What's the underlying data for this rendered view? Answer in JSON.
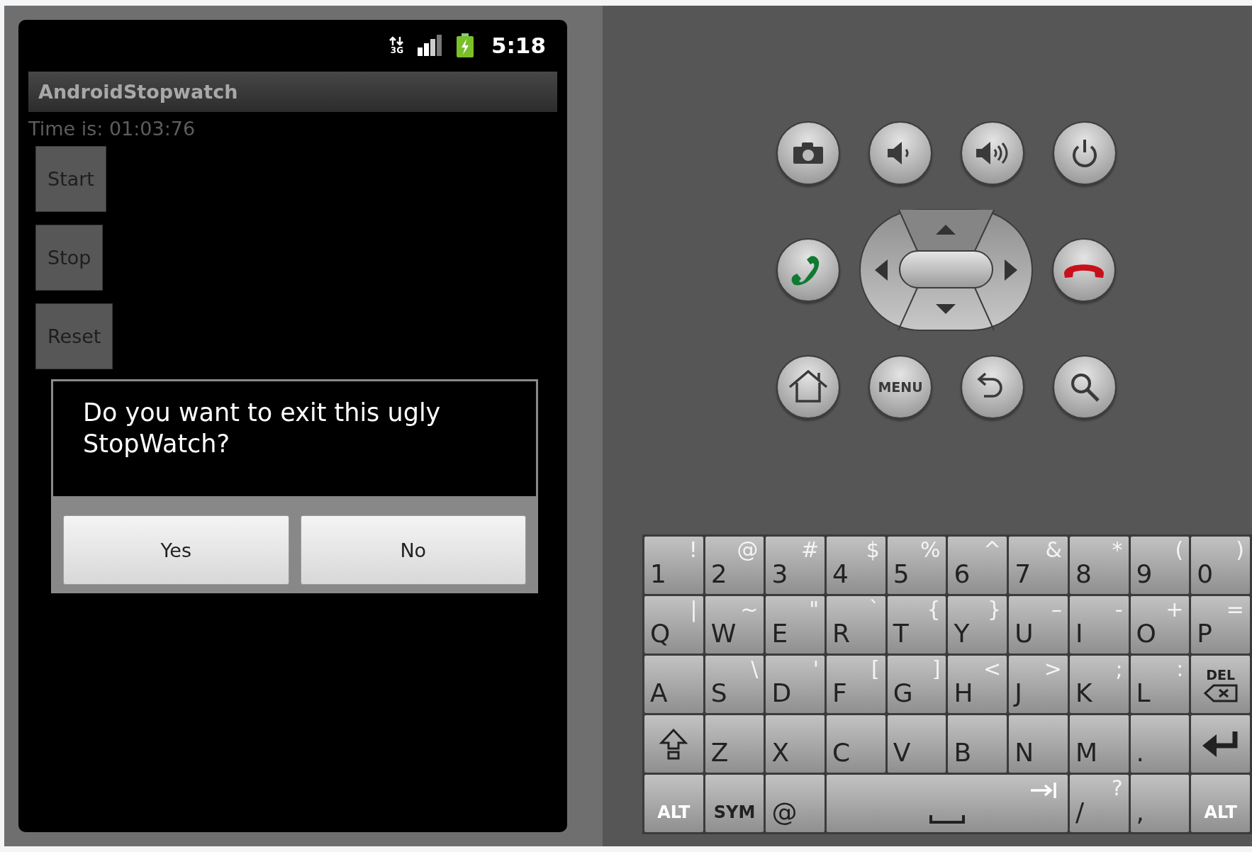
{
  "status_bar": {
    "network": "3G",
    "time": "5:18"
  },
  "app": {
    "title": "AndroidStopwatch",
    "time_label": "Time is: 01:03:76",
    "buttons": [
      "Start",
      "Stop",
      "Reset"
    ]
  },
  "dialog": {
    "message": "Do you want to exit this ugly StopWatch?",
    "buttons": [
      "Yes",
      "No"
    ]
  },
  "hardware_keys": [
    [
      {
        "kind": "camera"
      },
      {
        "kind": "volume_down"
      },
      {
        "kind": "volume_up"
      },
      {
        "kind": "power"
      }
    ],
    [
      {
        "kind": "call"
      },
      {
        "kind": "dpad"
      },
      {
        "kind": "end_call"
      }
    ],
    [
      {
        "kind": "home"
      },
      {
        "kind": "menu",
        "label": "MENU"
      },
      {
        "kind": "back"
      },
      {
        "kind": "search"
      }
    ]
  ],
  "keyboard": {
    "rows": [
      [
        {
          "kind": "char",
          "main": "1",
          "alt": "!"
        },
        {
          "kind": "char",
          "main": "2",
          "alt": "@"
        },
        {
          "kind": "char",
          "main": "3",
          "alt": "#"
        },
        {
          "kind": "char",
          "main": "4",
          "alt": "$"
        },
        {
          "kind": "char",
          "main": "5",
          "alt": "%"
        },
        {
          "kind": "char",
          "main": "6",
          "alt": "^"
        },
        {
          "kind": "char",
          "main": "7",
          "alt": "&"
        },
        {
          "kind": "char",
          "main": "8",
          "alt": "*"
        },
        {
          "kind": "char",
          "main": "9",
          "alt": "("
        },
        {
          "kind": "char",
          "main": "0",
          "alt": ")"
        }
      ],
      [
        {
          "kind": "char",
          "main": "Q",
          "alt": "|"
        },
        {
          "kind": "char",
          "main": "W",
          "alt": "~"
        },
        {
          "kind": "char",
          "main": "E",
          "alt": "\""
        },
        {
          "kind": "char",
          "main": "R",
          "alt": "`"
        },
        {
          "kind": "char",
          "main": "T",
          "alt": "{"
        },
        {
          "kind": "char",
          "main": "Y",
          "alt": "}"
        },
        {
          "kind": "char",
          "main": "U",
          "alt": "–"
        },
        {
          "kind": "char",
          "main": "I",
          "alt": "-"
        },
        {
          "kind": "char",
          "main": "O",
          "alt": "+"
        },
        {
          "kind": "char",
          "main": "P",
          "alt": "="
        }
      ],
      [
        {
          "kind": "char",
          "main": "A"
        },
        {
          "kind": "char",
          "main": "S",
          "alt": "\\"
        },
        {
          "kind": "char",
          "main": "D",
          "alt": "'"
        },
        {
          "kind": "char",
          "main": "F",
          "alt": "["
        },
        {
          "kind": "char",
          "main": "G",
          "alt": "]"
        },
        {
          "kind": "char",
          "main": "H",
          "alt": "<"
        },
        {
          "kind": "char",
          "main": "J",
          "alt": ">"
        },
        {
          "kind": "char",
          "main": "K",
          "alt": ";"
        },
        {
          "kind": "char",
          "main": "L",
          "alt": ":"
        },
        {
          "kind": "del",
          "label": "DEL"
        }
      ],
      [
        {
          "kind": "shift"
        },
        {
          "kind": "char",
          "main": "Z"
        },
        {
          "kind": "char",
          "main": "X"
        },
        {
          "kind": "char",
          "main": "C"
        },
        {
          "kind": "char",
          "main": "V"
        },
        {
          "kind": "char",
          "main": "B"
        },
        {
          "kind": "char",
          "main": "N"
        },
        {
          "kind": "char",
          "main": "M"
        },
        {
          "kind": "char",
          "main": "."
        },
        {
          "kind": "enter"
        }
      ]
    ],
    "bottom_row": [
      {
        "kind": "alt",
        "label": "ALT"
      },
      {
        "kind": "sym",
        "label": "SYM"
      },
      {
        "kind": "char",
        "main": "@"
      },
      {
        "kind": "space"
      },
      {
        "kind": "char",
        "main": "/",
        "alt": "?"
      },
      {
        "kind": "char",
        "main": ","
      },
      {
        "kind": "alt",
        "label": "ALT"
      }
    ]
  }
}
